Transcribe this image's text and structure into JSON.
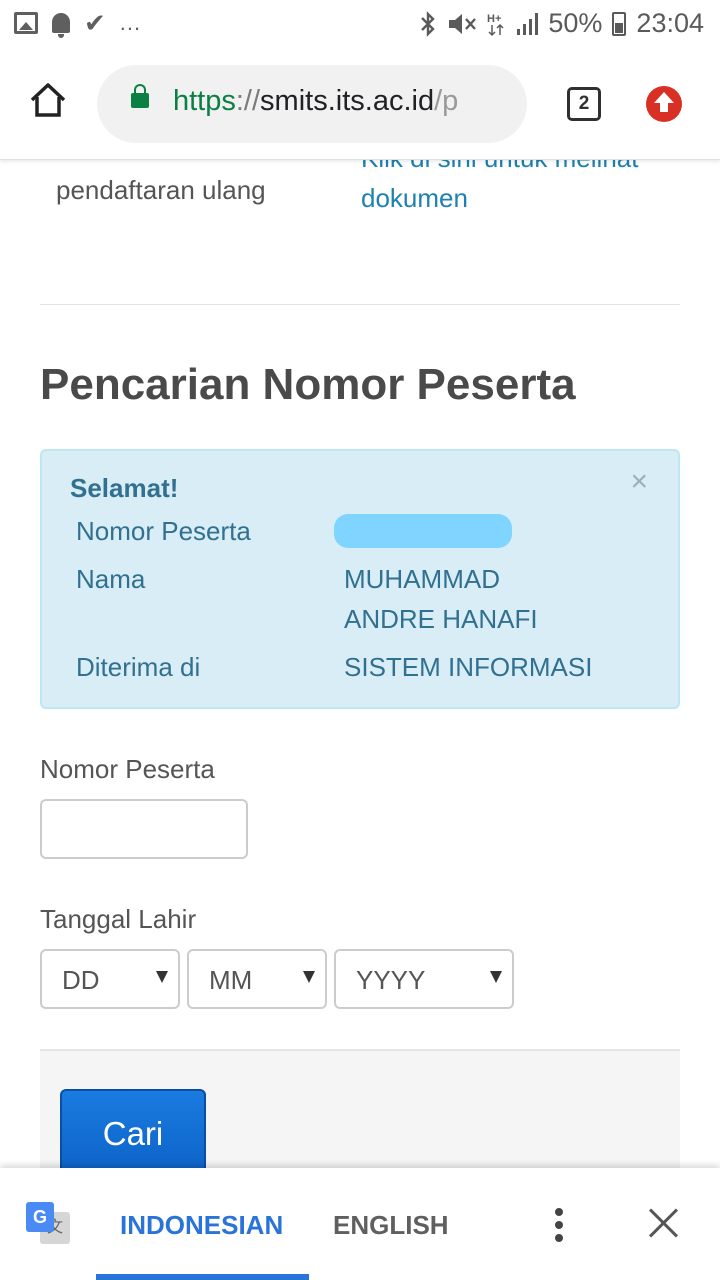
{
  "status_bar": {
    "more": "...",
    "battery": "50%",
    "time": "23:04",
    "icons": [
      "image-icon",
      "bell-icon",
      "check-icon",
      "bluetooth-icon",
      "mute-icon",
      "network-hplus-icon",
      "signal-icon",
      "battery-icon"
    ]
  },
  "browser": {
    "url_scheme": "https",
    "url_sep": "://",
    "url_host": "smits.its.ac.id",
    "url_path": "/p",
    "tab_count": "2"
  },
  "page": {
    "prev_label": "pendaftaran ulang",
    "prev_link": "Klik di sini untuk melihat dokumen",
    "section_title": "Pencarian Nomor Peserta",
    "alert": {
      "title": "Selamat!",
      "close": "×",
      "rows": [
        {
          "label": "Nomor Peserta",
          "value": ""
        },
        {
          "label": "Nama",
          "value": "MUHAMMAD ANDRE HANAFI"
        },
        {
          "label": "Diterima di",
          "value": "SISTEM INFORMASI"
        }
      ]
    },
    "form": {
      "nomor_label": "Nomor Peserta",
      "nomor_value": "",
      "tanggal_label": "Tanggal Lahir",
      "day": "DD",
      "month": "MM",
      "year": "YYYY",
      "submit": "Cari"
    }
  },
  "translate_bar": {
    "lang_active": "INDONESIAN",
    "lang_other": "ENGLISH",
    "g_letter": "G",
    "zh_letter": "文"
  },
  "colors": {
    "alert_bg": "#d9edf7",
    "alert_text": "#31708f",
    "link": "#1f81b0",
    "secure_green": "#0b8043",
    "button_blue": "#0b5fc4",
    "translate_blue": "#2a73d9"
  }
}
